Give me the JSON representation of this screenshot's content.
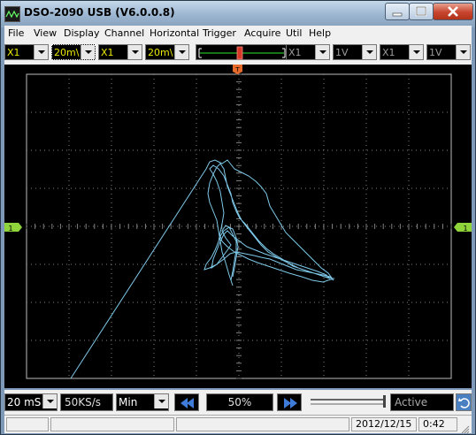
{
  "window": {
    "title": "DSO-2090 USB (V6.0.0.8)",
    "colors": {
      "trace": "#7ec8e8",
      "grid": "#808080",
      "ch1_marker": "#8fd43a",
      "trigger_marker": "#e86a2a"
    }
  },
  "menu": [
    "File",
    "View",
    "Display",
    "Channel",
    "Horizontal",
    "Trigger",
    "Acquire",
    "Util",
    "Help"
  ],
  "toolbar": {
    "ch1_probe": "X1",
    "ch1_voltdiv": "20m\\",
    "ch2_probe": "X1",
    "ch2_voltdiv": "20m\\",
    "ch3_probe": "X1",
    "ch3_voltdiv": "1V",
    "ch4_probe": "X1",
    "ch4_voltdiv": "1V"
  },
  "markers": {
    "left_channel": "1",
    "right_channel": "1",
    "trigger": "T"
  },
  "bottom": {
    "timebase": "20 mS",
    "sample_rate": "50KS/s",
    "mode": "Min",
    "position": "50%",
    "state": "Active"
  },
  "status": {
    "date": "2012/12/15",
    "time": "0:42"
  }
}
